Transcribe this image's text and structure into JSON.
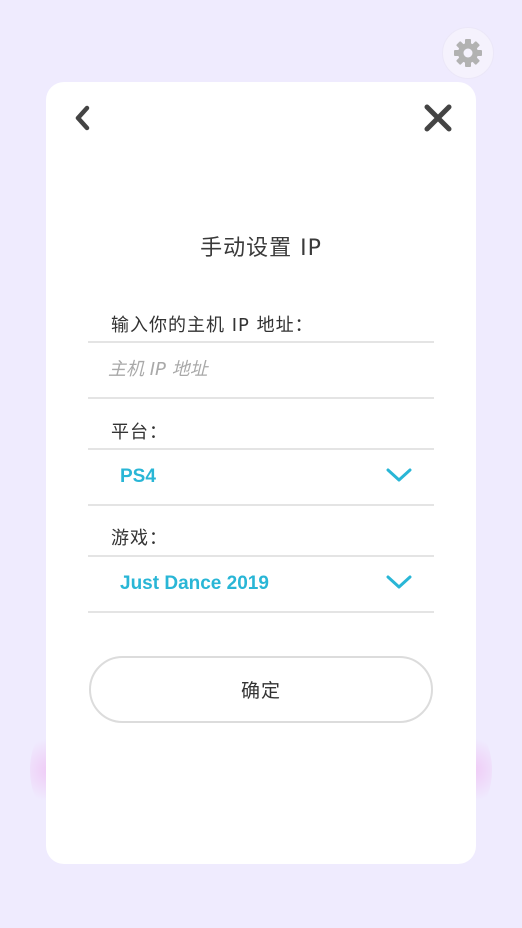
{
  "settings": {
    "icon": "gear-icon"
  },
  "dialog": {
    "back_icon": "chevron-left-icon",
    "close_icon": "close-icon",
    "title": "手动设置 IP",
    "ip_field": {
      "label": "输入你的主机 IP 地址：",
      "value": "",
      "placeholder": "主机 IP 地址"
    },
    "platform": {
      "label": "平台：",
      "selected": "PS4",
      "icon": "chevron-down-icon"
    },
    "game": {
      "label": "游戏：",
      "selected": "Just Dance 2019",
      "icon": "chevron-down-icon"
    },
    "confirm_label": "确定"
  },
  "colors": {
    "background": "#efebfe",
    "card": "#ffffff",
    "accent": "#29b6d6",
    "text": "#333333",
    "placeholder": "#a9a9a9",
    "divider": "#e4e4e4"
  }
}
